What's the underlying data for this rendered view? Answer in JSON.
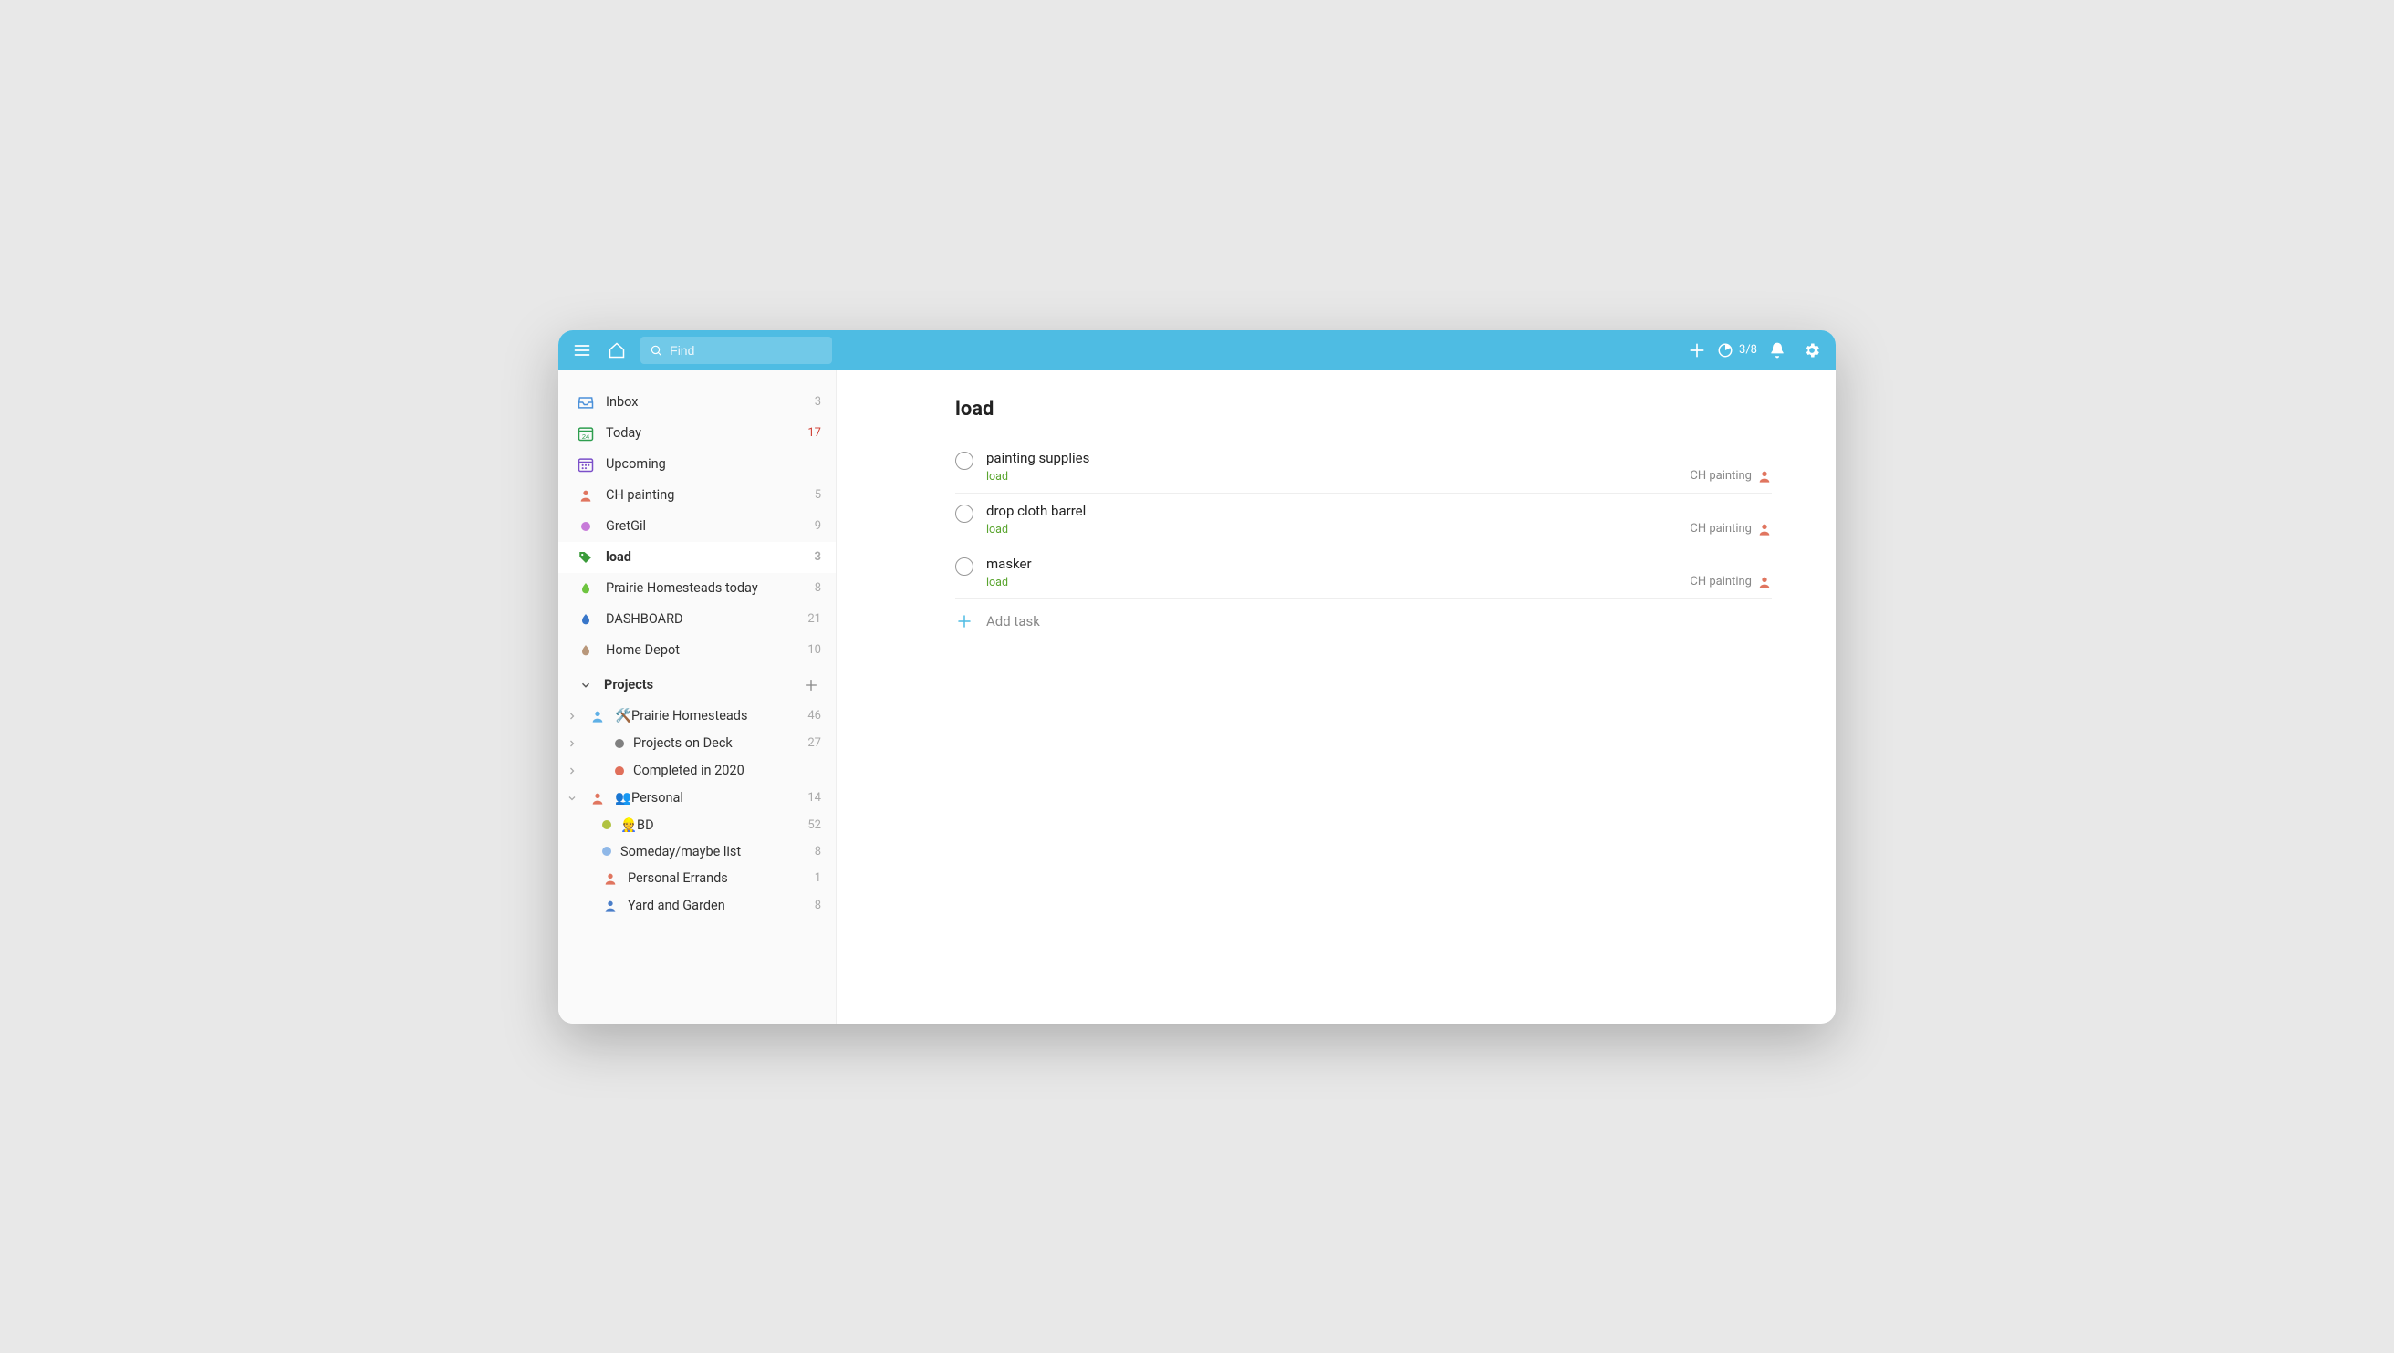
{
  "header": {
    "search_placeholder": "Find",
    "progress": "3/8"
  },
  "sidebar": {
    "smart": [
      {
        "label": "Inbox",
        "count": "3",
        "icon": "inbox",
        "countClass": "",
        "active": false
      },
      {
        "label": "Today",
        "count": "17",
        "icon": "today",
        "countClass": "red",
        "active": false
      },
      {
        "label": "Upcoming",
        "count": "",
        "icon": "upcoming",
        "countClass": "",
        "active": false
      }
    ],
    "favorites": [
      {
        "label": "CH painting",
        "count": "5",
        "icon": "person",
        "color": "#e0755f",
        "active": false,
        "bold": false
      },
      {
        "label": "GretGil",
        "count": "9",
        "icon": "dot",
        "color": "#c77bd9",
        "active": false,
        "bold": false
      },
      {
        "label": "load",
        "count": "3",
        "icon": "tag",
        "color": "#3b9b3b",
        "active": true,
        "bold": true
      },
      {
        "label": "Prairie Homesteads today",
        "count": "8",
        "icon": "drop",
        "color": "#6ec43f",
        "active": false,
        "bold": false
      },
      {
        "label": "DASHBOARD",
        "count": "21",
        "icon": "drop",
        "color": "#3876c9",
        "active": false,
        "bold": false
      },
      {
        "label": "Home Depot",
        "count": "10",
        "icon": "drop",
        "color": "#b8977a",
        "active": false,
        "bold": false
      }
    ],
    "projects_label": "Projects",
    "projects": [
      {
        "expand": "right",
        "shared": true,
        "shareColor": "#5fb0e6",
        "emoji": "🛠️",
        "label": "Prairie Homesteads",
        "count": "46",
        "child": false
      },
      {
        "expand": "right",
        "shared": false,
        "shareColor": "",
        "dot": "#808080",
        "label": "Projects on Deck",
        "count": "27",
        "child": false
      },
      {
        "expand": "right",
        "shared": false,
        "shareColor": "",
        "dot": "#e06f5a",
        "label": "Completed in 2020",
        "count": "",
        "child": false
      },
      {
        "expand": "down",
        "shared": true,
        "shareColor": "#e0755f",
        "emoji": "👥",
        "label": "Personal",
        "count": "14",
        "child": false
      },
      {
        "expand": "none",
        "shared": false,
        "shareColor": "",
        "dot": "#b0c241",
        "emoji": "👷",
        "label": "BD",
        "count": "52",
        "child": true
      },
      {
        "expand": "none",
        "shared": false,
        "shareColor": "",
        "dot": "#8fb8e8",
        "label": "Someday/maybe list",
        "count": "8",
        "child": true
      },
      {
        "expand": "none",
        "shared": true,
        "shareColor": "#e0755f",
        "label": "Personal Errands",
        "count": "1",
        "child": true
      },
      {
        "expand": "none",
        "shared": true,
        "shareColor": "#4a7ec9",
        "label": "Yard and Garden",
        "count": "8",
        "child": true
      }
    ]
  },
  "main": {
    "title": "load",
    "tasks": [
      {
        "title": "painting supplies",
        "tag": "load",
        "project": "CH painting"
      },
      {
        "title": "drop cloth barrel",
        "tag": "load",
        "project": "CH painting"
      },
      {
        "title": "masker",
        "tag": "load",
        "project": "CH painting"
      }
    ],
    "add_task_label": "Add task"
  }
}
